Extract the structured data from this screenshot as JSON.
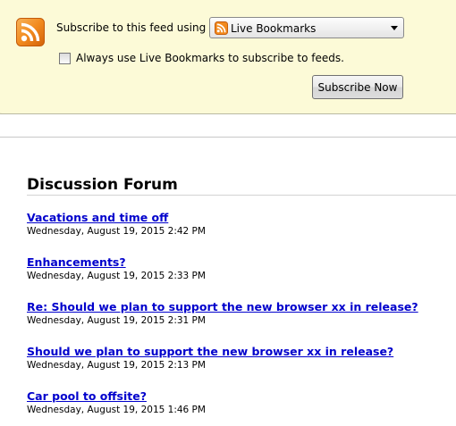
{
  "subscribe": {
    "label": "Subscribe to this feed using",
    "reader_selected": "Live Bookmarks",
    "always_use_label": "Always use Live Bookmarks to subscribe to feeds.",
    "always_use_checked": false,
    "button_label": "Subscribe Now"
  },
  "feed": {
    "title": "Discussion Forum",
    "entries": [
      {
        "title": "Vacations and time off",
        "date": "Wednesday, August 19, 2015 2:42 PM"
      },
      {
        "title": "Enhancements?",
        "date": "Wednesday, August 19, 2015 2:33 PM"
      },
      {
        "title": "Re: Should we plan to support the new browser xx in release?",
        "date": "Wednesday, August 19, 2015 2:31 PM"
      },
      {
        "title": "Should we plan to support the new browser xx in release?",
        "date": "Wednesday, August 19, 2015 2:13 PM"
      },
      {
        "title": "Car pool to offsite?",
        "date": "Wednesday, August 19, 2015 1:46 PM"
      }
    ]
  },
  "icons": {
    "feed_icon": "rss-feed-icon",
    "select_icon": "live-bookmarks-icon",
    "select_arrow": "dropdown-arrow-icon"
  },
  "colors": {
    "subscribe_background": "#fcfad7",
    "link": "#0000cc",
    "rss_orange": "#f28a1e"
  }
}
